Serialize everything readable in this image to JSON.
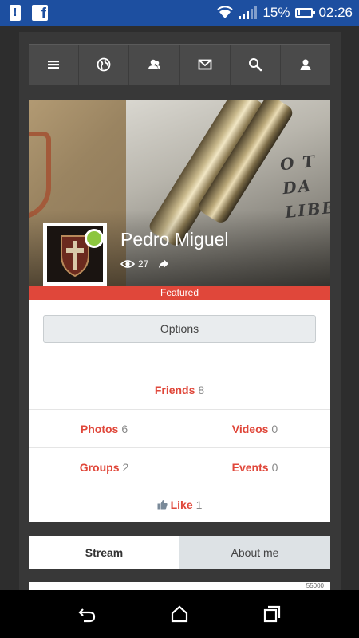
{
  "status_bar": {
    "battery_percent": "15%",
    "time": "02:26",
    "icons": [
      "alert-icon",
      "facebook-icon",
      "wifi-icon",
      "signal-icon",
      "battery-icon"
    ]
  },
  "toolbar": {
    "items": [
      {
        "icon": "menu-icon"
      },
      {
        "icon": "globe-icon"
      },
      {
        "icon": "friends-icon"
      },
      {
        "icon": "mail-icon"
      },
      {
        "icon": "search-icon"
      },
      {
        "icon": "user-icon"
      }
    ]
  },
  "profile": {
    "name": "Pedro Miguel",
    "views": "27",
    "online": true,
    "featured_label": "Featured",
    "cover_text": [
      "O T",
      "DA",
      "LIBER"
    ]
  },
  "options": {
    "label": "Options"
  },
  "counts": {
    "friends": {
      "label": "Friends",
      "count": "8"
    },
    "photos": {
      "label": "Photos",
      "count": "6"
    },
    "videos": {
      "label": "Videos",
      "count": "0"
    },
    "groups": {
      "label": "Groups",
      "count": "2"
    },
    "events": {
      "label": "Events",
      "count": "0"
    },
    "like": {
      "label": "Like",
      "count": "1"
    }
  },
  "tabs": {
    "stream": "Stream",
    "about": "About me"
  },
  "next_card": {
    "snippet": "55000"
  },
  "colors": {
    "accent": "#e0473a",
    "online": "#8cc63f",
    "status_bar": "#1d4fa0"
  },
  "nav_bar": {
    "icons": [
      "back-icon",
      "home-icon",
      "recents-icon"
    ]
  }
}
